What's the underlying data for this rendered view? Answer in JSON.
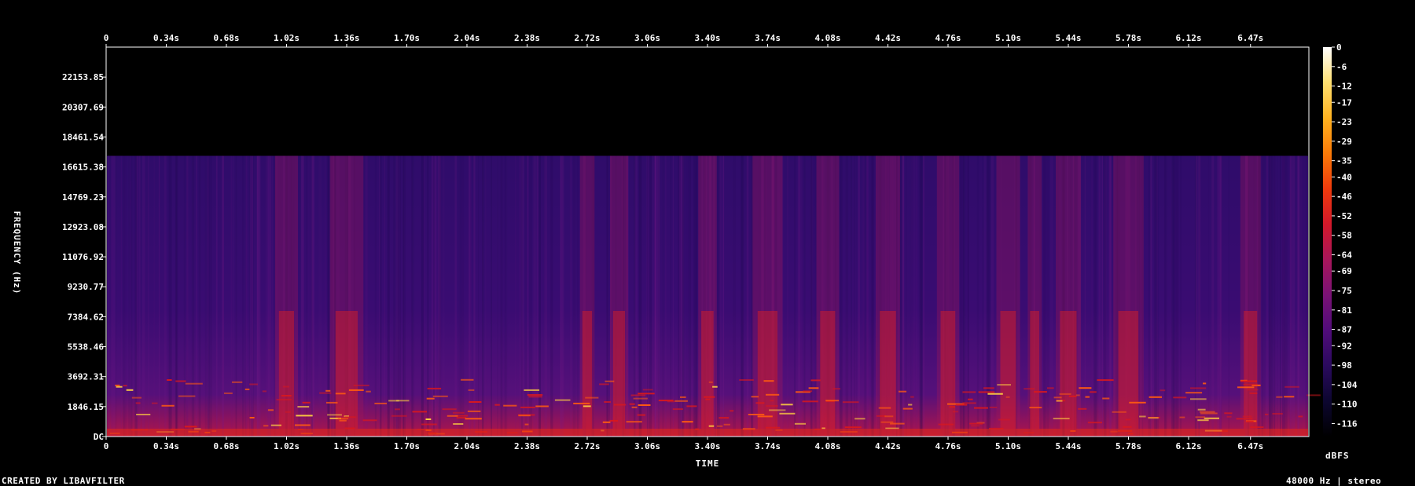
{
  "chart_data": {
    "type": "heatmap",
    "subtype": "spectrogram",
    "xlabel": "TIME",
    "ylabel": "FREQUENCY (Hz)",
    "x_ticks_top": [
      "0",
      "0.34s",
      "0.68s",
      "1.02s",
      "1.36s",
      "1.70s",
      "2.04s",
      "2.38s",
      "2.72s",
      "3.06s",
      "3.40s",
      "3.74s",
      "4.08s",
      "4.42s",
      "4.76s",
      "5.10s",
      "5.44s",
      "5.78s",
      "6.12s",
      "6.47s"
    ],
    "x_ticks_bottom": [
      "0",
      "0.34s",
      "0.68s",
      "1.02s",
      "1.36s",
      "1.70s",
      "2.04s",
      "2.38s",
      "2.72s",
      "3.06s",
      "3.40s",
      "3.74s",
      "4.08s",
      "4.42s",
      "4.76s",
      "5.10s",
      "5.44s",
      "5.78s",
      "6.12s",
      "6.47s"
    ],
    "x_tick_values": [
      0,
      0.34,
      0.68,
      1.02,
      1.36,
      1.7,
      2.04,
      2.38,
      2.72,
      3.06,
      3.4,
      3.74,
      4.08,
      4.42,
      4.76,
      5.1,
      5.44,
      5.78,
      6.12,
      6.47
    ],
    "xlim": [
      0,
      6.8
    ],
    "y_ticks": [
      "DC",
      "1846.15",
      "3692.31",
      "5538.46",
      "7384.62",
      "9230.77",
      "11076.92",
      "12923.08",
      "14769.23",
      "16615.38",
      "18461.54",
      "20307.69",
      "22153.85"
    ],
    "y_tick_values": [
      0,
      1846.15,
      3692.31,
      5538.46,
      7384.62,
      9230.77,
      11076.92,
      12923.08,
      14769.23,
      16615.38,
      18461.54,
      20307.69,
      22153.85
    ],
    "ylim": [
      0,
      24000
    ],
    "content_cutoff_hz": 17300,
    "colorbar_ticks": [
      "0",
      "-6",
      "-12",
      "-17",
      "-23",
      "-29",
      "-35",
      "-40",
      "-46",
      "-52",
      "-58",
      "-64",
      "-69",
      "-75",
      "-81",
      "-87",
      "-92",
      "-98",
      "-104",
      "-110",
      "-116"
    ],
    "colorbar_values": [
      0,
      -6,
      -12,
      -17,
      -23,
      -29,
      -35,
      -40,
      -46,
      -52,
      -58,
      -64,
      -69,
      -75,
      -81,
      -87,
      -92,
      -98,
      -104,
      -110,
      -116
    ],
    "colorbar_range": [
      -120,
      0
    ],
    "colorbar_label": "dBFS",
    "colorbar_colors": [
      "#000000",
      "#0c0630",
      "#2a0a5e",
      "#510c7a",
      "#7a1275",
      "#a7165a",
      "#d2182a",
      "#ee3a0c",
      "#fa7a08",
      "#ffb220",
      "#ffe070",
      "#ffffff"
    ],
    "bright_times": [
      1.02,
      1.36,
      2.72,
      2.9,
      3.4,
      3.74,
      4.08,
      4.42,
      4.76,
      5.1,
      5.25,
      5.44,
      5.78,
      6.47
    ],
    "grid": false
  },
  "footer": {
    "left": "CREATED BY LIBAVFILTER",
    "right": "48000 Hz | stereo"
  }
}
